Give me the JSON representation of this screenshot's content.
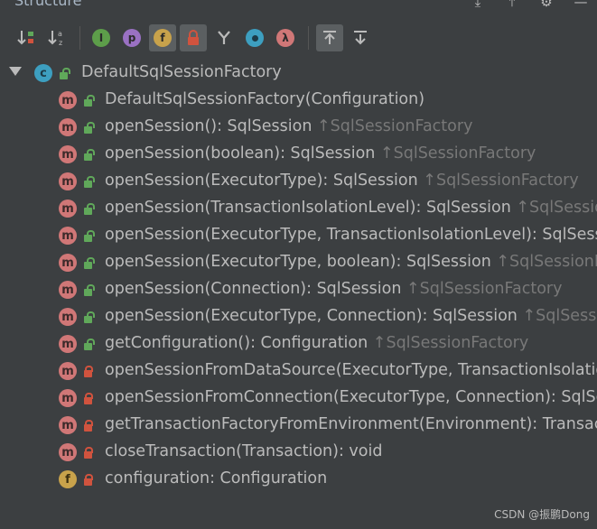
{
  "panel": {
    "title": "Structure",
    "header_icons": [
      "expand-all-icon",
      "collapse-all-icon",
      "settings-icon",
      "hide-icon"
    ]
  },
  "toolbar": {
    "buttons": [
      {
        "name": "sort-by-visibility",
        "label": ""
      },
      {
        "name": "sort-alphabetically",
        "label": "a z"
      },
      {
        "name": "show-inherited",
        "label": "I"
      },
      {
        "name": "show-properties",
        "label": "p"
      },
      {
        "name": "show-fields",
        "label": "f"
      },
      {
        "name": "show-non-public",
        "label": ""
      },
      {
        "name": "show-interfaces",
        "label": ""
      },
      {
        "name": "show-anonymous",
        "label": ""
      },
      {
        "name": "show-lambdas",
        "label": "λ"
      },
      {
        "name": "autoscroll-to-source",
        "label": ""
      },
      {
        "name": "autoscroll-from-source",
        "label": ""
      }
    ],
    "colors": {
      "inherited": "#5d9e4a",
      "properties": "#9a71c3",
      "fields": "#c8a24b",
      "anonymous": "#3d9fc0",
      "lambdas": "#d07777"
    }
  },
  "tree": {
    "root": {
      "kind": "c",
      "label": "DefaultSqlSessionFactory"
    },
    "members": [
      {
        "kind": "m",
        "visibility": "public",
        "label": "DefaultSqlSessionFactory(Configuration)",
        "inherited": ""
      },
      {
        "kind": "m",
        "visibility": "public",
        "label": "openSession(): SqlSession",
        "inherited": "↑SqlSessionFactory"
      },
      {
        "kind": "m",
        "visibility": "public",
        "label": "openSession(boolean): SqlSession",
        "inherited": "↑SqlSessionFactory"
      },
      {
        "kind": "m",
        "visibility": "public",
        "label": "openSession(ExecutorType): SqlSession",
        "inherited": "↑SqlSessionFactory"
      },
      {
        "kind": "m",
        "visibility": "public",
        "label": "openSession(TransactionIsolationLevel): SqlSession",
        "inherited": "↑SqlSession"
      },
      {
        "kind": "m",
        "visibility": "public",
        "label": "openSession(ExecutorType, TransactionIsolationLevel): SqlSessi",
        "inherited": ""
      },
      {
        "kind": "m",
        "visibility": "public",
        "label": "openSession(ExecutorType, boolean): SqlSession",
        "inherited": "↑SqlSessionFa"
      },
      {
        "kind": "m",
        "visibility": "public",
        "label": "openSession(Connection): SqlSession",
        "inherited": "↑SqlSessionFactory"
      },
      {
        "kind": "m",
        "visibility": "public",
        "label": "openSession(ExecutorType, Connection): SqlSession",
        "inherited": "↑SqlSessio"
      },
      {
        "kind": "m",
        "visibility": "public",
        "label": "getConfiguration(): Configuration",
        "inherited": "↑SqlSessionFactory"
      },
      {
        "kind": "m",
        "visibility": "private",
        "label": "openSessionFromDataSource(ExecutorType, TransactionIsolatio",
        "inherited": ""
      },
      {
        "kind": "m",
        "visibility": "private",
        "label": "openSessionFromConnection(ExecutorType, Connection): SqlSe",
        "inherited": ""
      },
      {
        "kind": "m",
        "visibility": "private",
        "label": "getTransactionFactoryFromEnvironment(Environment): Transac",
        "inherited": ""
      },
      {
        "kind": "m",
        "visibility": "private",
        "label": "closeTransaction(Transaction): void",
        "inherited": ""
      },
      {
        "kind": "f",
        "visibility": "private",
        "label": "configuration: Configuration",
        "inherited": ""
      }
    ]
  },
  "watermark": "CSDN @振鹏Dong"
}
